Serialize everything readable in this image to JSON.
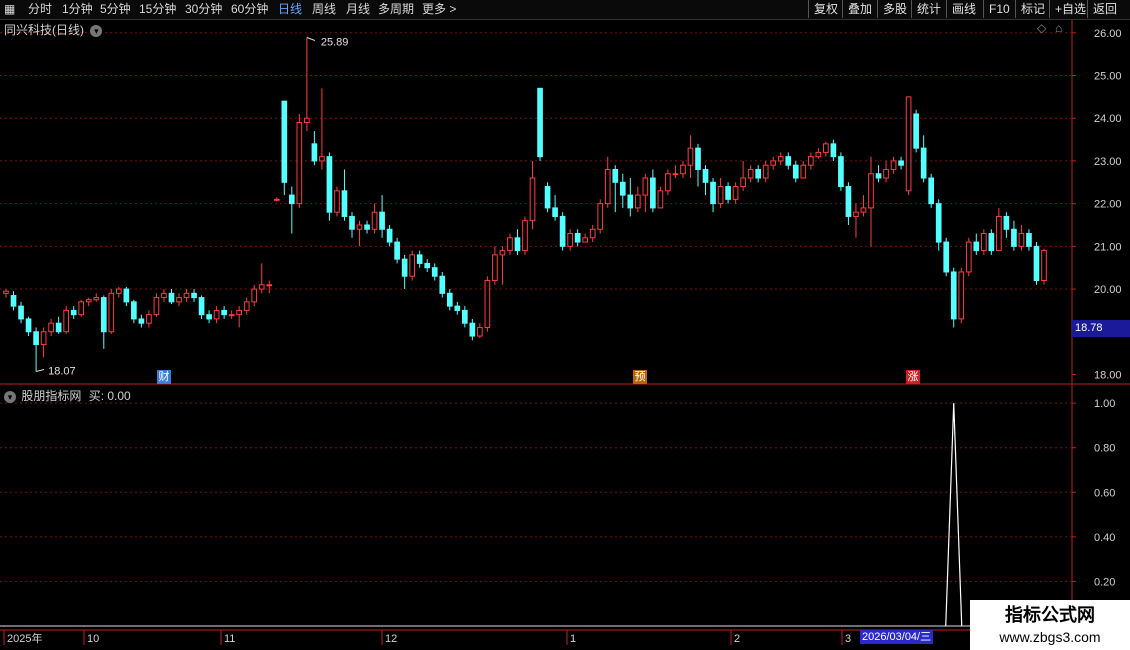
{
  "toolbar": {
    "periods": [
      "分时",
      "1分钟",
      "5分钟",
      "15分钟",
      "30分钟",
      "60分钟",
      "日线",
      "周线",
      "月线",
      "多周期",
      "更多 >"
    ],
    "right_buttons": [
      "复权",
      "叠加",
      "多股",
      "统计",
      "画线",
      "F10",
      "标记",
      "+自选",
      "返回"
    ]
  },
  "main_panel": {
    "title": "同兴科技(日线)",
    "price_labels": [
      "26.00",
      "25.00",
      "24.00",
      "23.00",
      "22.00",
      "21.00",
      "20.00",
      "18.00"
    ],
    "current_price_tag": "18.78",
    "high_label": "25.89",
    "low_label": "18.07",
    "markers": [
      {
        "text": "财",
        "color": "#3c7bd6"
      },
      {
        "text": "预",
        "color": "#b8660a"
      },
      {
        "text": "涨",
        "color": "#cc2222"
      }
    ]
  },
  "indicator_panel": {
    "title": "股朋指标网",
    "value_label": "买: 0.00",
    "axis_labels": [
      "1.00",
      "0.80",
      "0.60",
      "0.40",
      "0.20"
    ]
  },
  "time_axis": {
    "labels": [
      "2025年",
      "10",
      "11",
      "12",
      "1",
      "2",
      "3"
    ],
    "current_date": "2026/03/04/三"
  },
  "watermark": {
    "line1": "指标公式网",
    "line2": "www.zbgs3.com"
  },
  "colors": {
    "up": "#ff3c3c",
    "down": "#54ffff",
    "grid": "#7a1010",
    "axis": "#c02020"
  },
  "chart_data": {
    "type": "candlestick",
    "ylim": [
      17.8,
      26.3
    ],
    "candles": [
      [
        19.9,
        19.95,
        20.0,
        19.8
      ],
      [
        19.85,
        19.6,
        19.95,
        19.5
      ],
      [
        19.6,
        19.3,
        19.7,
        19.2
      ],
      [
        19.3,
        19.0,
        19.35,
        18.9
      ],
      [
        19.0,
        18.7,
        19.1,
        18.07
      ],
      [
        18.7,
        19.0,
        19.1,
        18.4
      ],
      [
        19.0,
        19.2,
        19.3,
        18.9
      ],
      [
        19.2,
        19.0,
        19.35,
        18.95
      ],
      [
        19.0,
        19.5,
        19.6,
        18.95
      ],
      [
        19.5,
        19.4,
        19.6,
        19.3
      ],
      [
        19.4,
        19.7,
        19.75,
        19.35
      ],
      [
        19.7,
        19.75,
        19.8,
        19.6
      ],
      [
        19.75,
        19.8,
        19.9,
        19.7
      ],
      [
        19.8,
        19.0,
        19.85,
        18.6
      ],
      [
        19.0,
        19.9,
        20.0,
        18.95
      ],
      [
        19.9,
        20.0,
        20.05,
        19.8
      ],
      [
        20.0,
        19.7,
        20.05,
        19.6
      ],
      [
        19.7,
        19.3,
        19.75,
        19.2
      ],
      [
        19.3,
        19.2,
        19.4,
        19.1
      ],
      [
        19.2,
        19.4,
        19.5,
        19.1
      ],
      [
        19.4,
        19.8,
        19.9,
        19.35
      ],
      [
        19.8,
        19.9,
        20.0,
        19.7
      ],
      [
        19.9,
        19.7,
        20.0,
        19.65
      ],
      [
        19.7,
        19.8,
        19.9,
        19.6
      ],
      [
        19.8,
        19.9,
        20.0,
        19.7
      ],
      [
        19.9,
        19.8,
        20.0,
        19.7
      ],
      [
        19.8,
        19.4,
        19.85,
        19.3
      ],
      [
        19.4,
        19.3,
        19.5,
        19.2
      ],
      [
        19.3,
        19.5,
        19.6,
        19.2
      ],
      [
        19.5,
        19.4,
        19.6,
        19.3
      ],
      [
        19.4,
        19.4,
        19.5,
        19.3
      ],
      [
        19.4,
        19.5,
        19.6,
        19.1
      ],
      [
        19.5,
        19.7,
        19.8,
        19.4
      ],
      [
        19.7,
        20.0,
        20.1,
        19.6
      ],
      [
        20.0,
        20.1,
        20.6,
        19.9
      ],
      [
        20.1,
        20.1,
        20.2,
        19.9
      ],
      [
        22.1,
        22.1,
        22.15,
        22.05
      ],
      [
        24.4,
        22.5,
        24.4,
        22.2
      ],
      [
        22.2,
        22.0,
        22.4,
        21.3
      ],
      [
        22.0,
        23.9,
        24.1,
        21.9
      ],
      [
        23.9,
        24.0,
        25.89,
        23.7
      ],
      [
        23.4,
        23.0,
        23.7,
        22.9
      ],
      [
        23.0,
        23.1,
        24.7,
        22.8
      ],
      [
        23.1,
        21.8,
        23.2,
        21.6
      ],
      [
        21.8,
        22.3,
        22.4,
        21.7
      ],
      [
        22.3,
        21.7,
        22.8,
        21.6
      ],
      [
        21.7,
        21.4,
        21.8,
        21.2
      ],
      [
        21.4,
        21.5,
        21.6,
        21.0
      ],
      [
        21.5,
        21.4,
        21.6,
        21.3
      ],
      [
        21.4,
        21.8,
        22.0,
        21.3
      ],
      [
        21.8,
        21.4,
        22.2,
        21.2
      ],
      [
        21.4,
        21.1,
        21.5,
        21.0
      ],
      [
        21.1,
        20.7,
        21.2,
        20.6
      ],
      [
        20.7,
        20.3,
        20.8,
        20.0
      ],
      [
        20.3,
        20.8,
        20.9,
        20.2
      ],
      [
        20.8,
        20.6,
        20.9,
        20.5
      ],
      [
        20.6,
        20.5,
        20.7,
        20.4
      ],
      [
        20.5,
        20.3,
        20.6,
        20.2
      ],
      [
        20.3,
        19.9,
        20.4,
        19.8
      ],
      [
        19.9,
        19.6,
        20.0,
        19.5
      ],
      [
        19.6,
        19.5,
        19.7,
        19.4
      ],
      [
        19.5,
        19.2,
        19.6,
        19.1
      ],
      [
        19.2,
        18.9,
        19.3,
        18.8
      ],
      [
        18.9,
        19.1,
        19.2,
        18.85
      ],
      [
        19.1,
        20.2,
        20.3,
        19.0
      ],
      [
        20.2,
        20.8,
        21.0,
        20.1
      ],
      [
        20.8,
        20.9,
        21.0,
        20.1
      ],
      [
        20.9,
        21.2,
        21.3,
        20.8
      ],
      [
        21.2,
        20.9,
        21.4,
        20.8
      ],
      [
        20.9,
        21.6,
        21.7,
        20.8
      ],
      [
        21.6,
        22.6,
        23.0,
        21.4
      ],
      [
        24.7,
        23.1,
        24.7,
        23.0
      ],
      [
        22.4,
        21.9,
        22.5,
        21.8
      ],
      [
        21.9,
        21.7,
        22.2,
        21.6
      ],
      [
        21.7,
        21.0,
        21.8,
        20.9
      ],
      [
        21.0,
        21.3,
        21.4,
        20.9
      ],
      [
        21.3,
        21.1,
        21.4,
        21.0
      ],
      [
        21.1,
        21.2,
        21.3,
        21.1
      ],
      [
        21.2,
        21.4,
        21.5,
        21.1
      ],
      [
        21.4,
        22.0,
        22.1,
        21.3
      ],
      [
        22.0,
        22.8,
        23.1,
        21.9
      ],
      [
        22.8,
        22.5,
        22.9,
        21.8
      ],
      [
        22.5,
        22.2,
        22.7,
        21.9
      ],
      [
        22.2,
        21.9,
        22.6,
        21.7
      ],
      [
        21.9,
        22.2,
        22.4,
        21.8
      ],
      [
        22.2,
        22.6,
        22.7,
        21.8
      ],
      [
        22.6,
        21.9,
        22.8,
        21.8
      ],
      [
        21.9,
        22.3,
        22.4,
        21.9
      ],
      [
        22.3,
        22.7,
        22.8,
        22.2
      ],
      [
        22.7,
        22.7,
        22.9,
        22.6
      ],
      [
        22.7,
        22.9,
        23.0,
        22.6
      ],
      [
        22.9,
        23.3,
        23.6,
        22.6
      ],
      [
        23.3,
        22.8,
        23.4,
        22.4
      ],
      [
        22.8,
        22.5,
        22.9,
        22.2
      ],
      [
        22.5,
        22.0,
        22.6,
        21.8
      ],
      [
        22.0,
        22.4,
        22.6,
        21.9
      ],
      [
        22.4,
        22.1,
        22.5,
        22.0
      ],
      [
        22.1,
        22.4,
        22.5,
        22.0
      ],
      [
        22.4,
        22.6,
        23.0,
        22.3
      ],
      [
        22.6,
        22.8,
        22.9,
        22.5
      ],
      [
        22.8,
        22.6,
        22.9,
        22.5
      ],
      [
        22.6,
        22.9,
        23.0,
        22.5
      ],
      [
        22.9,
        23.0,
        23.1,
        22.8
      ],
      [
        23.0,
        23.1,
        23.2,
        22.9
      ],
      [
        23.1,
        22.9,
        23.2,
        22.8
      ],
      [
        22.9,
        22.6,
        23.0,
        22.5
      ],
      [
        22.6,
        22.9,
        23.0,
        22.6
      ],
      [
        22.9,
        23.1,
        23.2,
        22.8
      ],
      [
        23.1,
        23.2,
        23.3,
        23.05
      ],
      [
        23.2,
        23.4,
        23.45,
        23.1
      ],
      [
        23.4,
        23.1,
        23.5,
        23.0
      ],
      [
        23.1,
        22.4,
        23.2,
        22.3
      ],
      [
        22.4,
        21.7,
        22.5,
        21.5
      ],
      [
        21.7,
        21.8,
        22.0,
        21.2
      ],
      [
        21.8,
        21.9,
        22.2,
        21.7
      ],
      [
        21.9,
        22.7,
        23.1,
        21.0
      ],
      [
        22.7,
        22.6,
        22.9,
        22.5
      ],
      [
        22.6,
        22.8,
        23.0,
        22.5
      ],
      [
        22.8,
        23.0,
        23.1,
        22.7
      ],
      [
        23.0,
        22.9,
        23.1,
        22.8
      ],
      [
        22.3,
        24.5,
        24.5,
        22.2
      ],
      [
        24.1,
        23.3,
        24.2,
        23.2
      ],
      [
        23.3,
        22.6,
        23.6,
        22.5
      ],
      [
        22.6,
        22.0,
        22.7,
        21.9
      ],
      [
        22.0,
        21.1,
        22.1,
        20.9
      ],
      [
        21.1,
        20.4,
        21.2,
        20.3
      ],
      [
        20.4,
        19.3,
        20.5,
        19.1
      ],
      [
        19.3,
        20.4,
        20.5,
        19.2
      ],
      [
        20.4,
        21.1,
        21.2,
        20.3
      ],
      [
        21.1,
        20.9,
        21.3,
        20.8
      ],
      [
        20.9,
        21.3,
        21.4,
        20.8
      ],
      [
        21.3,
        20.9,
        21.4,
        20.8
      ],
      [
        20.9,
        21.7,
        21.9,
        20.9
      ],
      [
        21.7,
        21.4,
        21.8,
        21.2
      ],
      [
        21.4,
        21.0,
        21.6,
        20.9
      ],
      [
        21.0,
        21.3,
        21.5,
        20.9
      ],
      [
        21.3,
        21.0,
        21.4,
        20.9
      ],
      [
        21.0,
        20.2,
        21.1,
        20.1
      ],
      [
        20.2,
        20.9,
        20.95,
        20.1
      ]
    ],
    "indicator": {
      "name": "买",
      "peak_index": 126,
      "peak_value": 1.0,
      "ylim": [
        0,
        1.05
      ]
    }
  }
}
